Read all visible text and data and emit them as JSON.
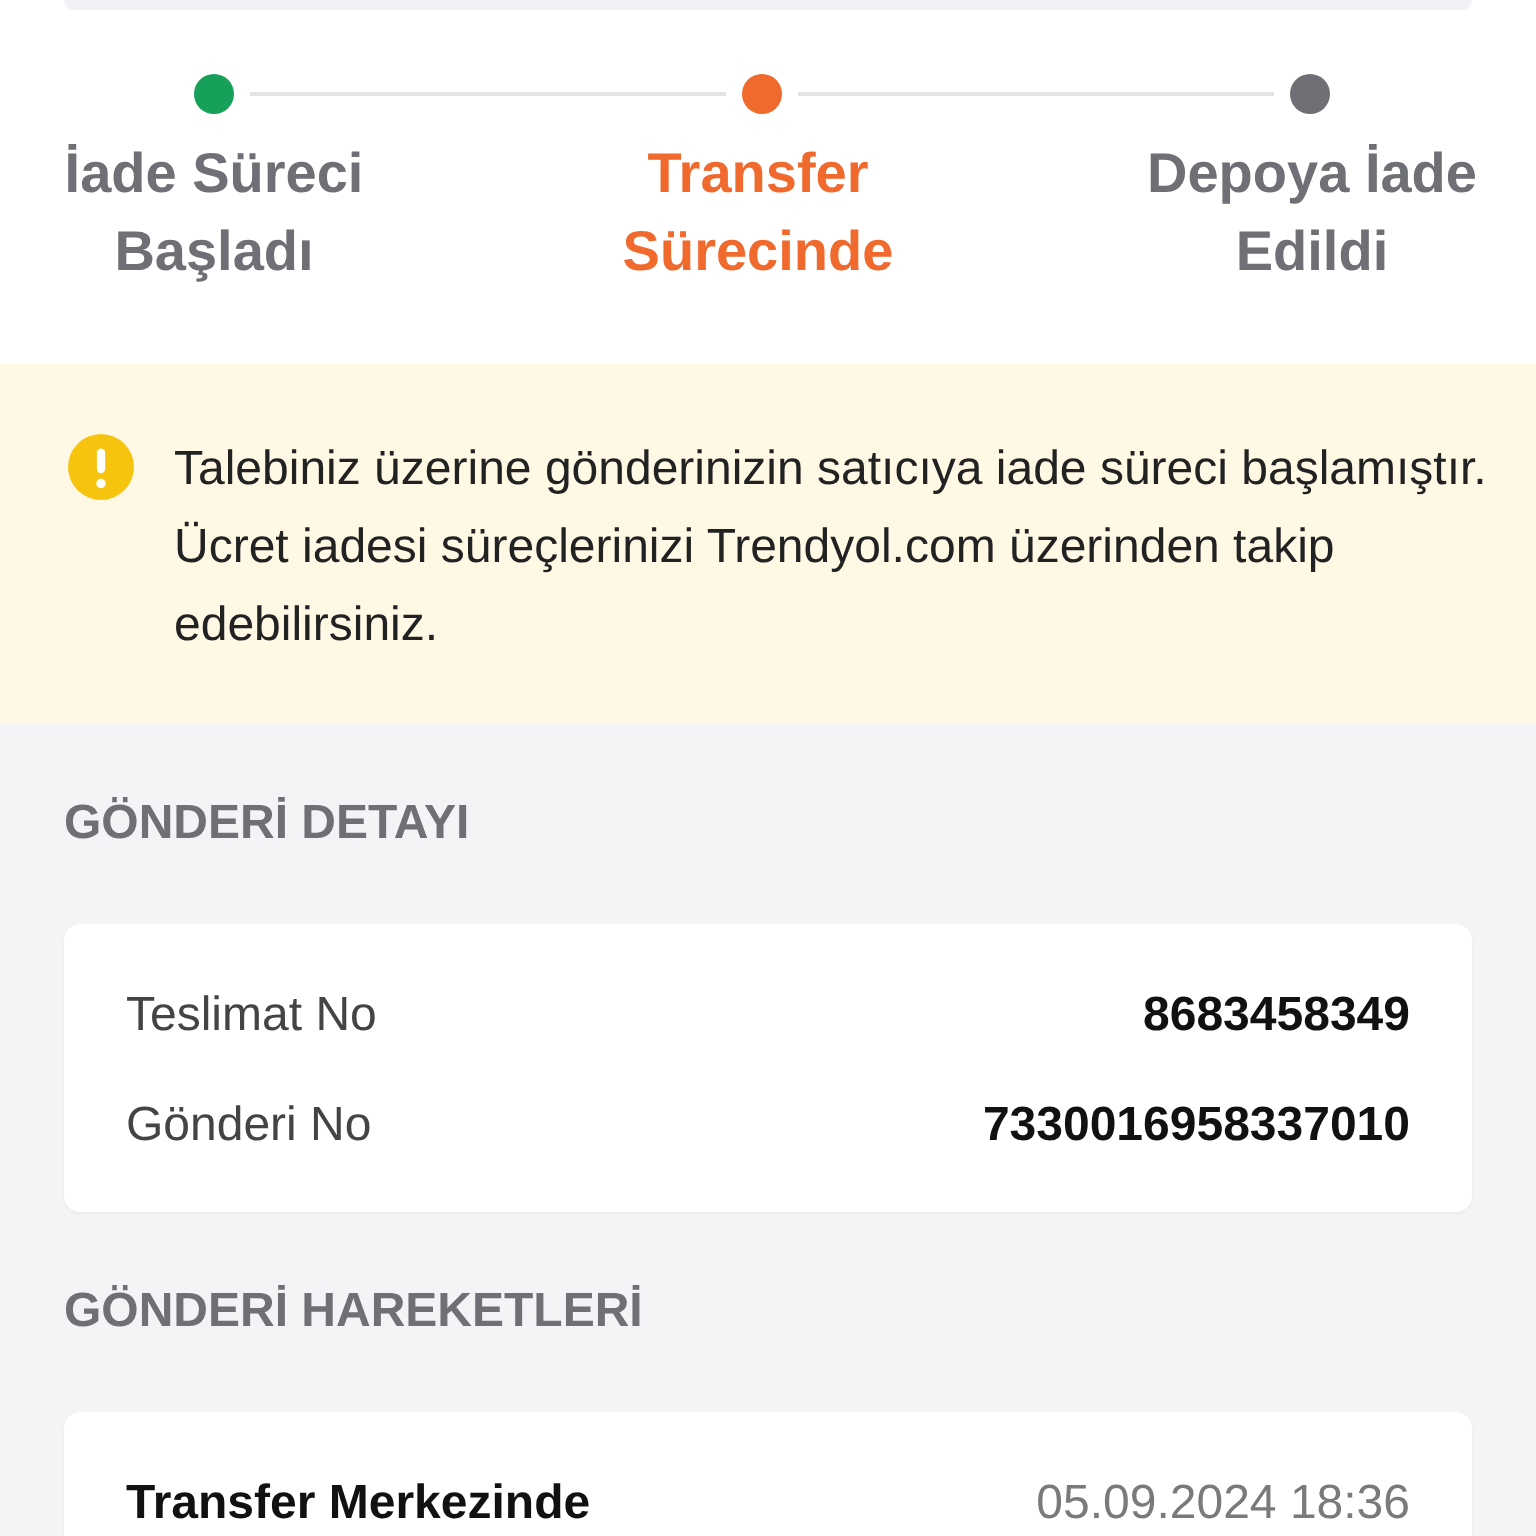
{
  "steps": [
    {
      "label": "İade Süreci Başladı",
      "color": "#16a05a",
      "selected": false
    },
    {
      "label": "Transfer Sürecinde",
      "color": "#f0692d",
      "selected": true
    },
    {
      "label": "Depoya İade Edildi",
      "color": "#6f7075",
      "selected": false
    }
  ],
  "notice": {
    "text": "Talebiniz üzerine gönderinizin satıcıya iade süreci başlamıştır. Ücret iadesi süreçlerinizi Trendyol.com üzerinden takip edebilirsiniz."
  },
  "shipment_details": {
    "title": "GÖNDERİ DETAYI",
    "rows": [
      {
        "label": "Teslimat No",
        "value": "8683458349"
      },
      {
        "label": "Gönderi No",
        "value": "7330016958337010"
      }
    ]
  },
  "shipment_movements": {
    "title": "GÖNDERİ HAREKETLERİ",
    "events": [
      {
        "status": "Transfer Merkezinde",
        "time": "05.09.2024 18:36"
      }
    ]
  }
}
